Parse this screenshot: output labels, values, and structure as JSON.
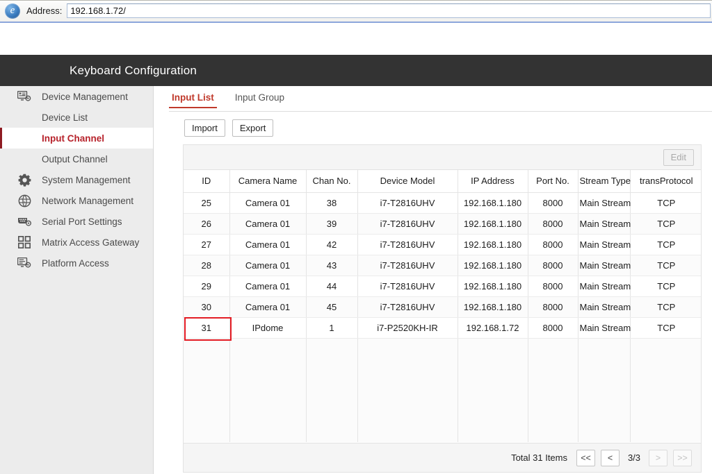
{
  "browser": {
    "icon": "internet-explorer-icon",
    "address_label": "Address:",
    "address_value": "192.168.1.72/",
    "address_placeholder": ""
  },
  "header": {
    "title": "Keyboard Configuration",
    "background": "#333333"
  },
  "sidebar": {
    "active_color": "#b7222b",
    "items": [
      {
        "label": "Device Management",
        "icon": "monitor-gear-icon",
        "type": "group",
        "active": false
      },
      {
        "label": "Device List",
        "icon": "",
        "type": "sub",
        "active": false
      },
      {
        "label": "Input Channel",
        "icon": "",
        "type": "sub",
        "active": true
      },
      {
        "label": "Output Channel",
        "icon": "",
        "type": "sub",
        "active": false
      },
      {
        "label": "System Management",
        "icon": "gear-icon",
        "type": "group",
        "active": false
      },
      {
        "label": "Network Management",
        "icon": "globe-icon",
        "type": "group",
        "active": false
      },
      {
        "label": "Serial Port Settings",
        "icon": "serial-port-gear-icon",
        "type": "group",
        "active": false
      },
      {
        "label": "Matrix Access Gateway",
        "icon": "grid-squares-icon",
        "type": "group",
        "active": false
      },
      {
        "label": "Platform Access",
        "icon": "platform-gear-icon",
        "type": "group",
        "active": false
      }
    ]
  },
  "main": {
    "tabs": [
      {
        "label": "Input List",
        "active": true
      },
      {
        "label": "Input Group",
        "active": false
      }
    ],
    "actions": {
      "import_label": "Import",
      "export_label": "Export"
    },
    "toolbar": {
      "edit_label": "Edit",
      "edit_disabled": true
    },
    "table": {
      "columns": [
        "ID",
        "Camera Name",
        "Chan No.",
        "Device Model",
        "IP Address",
        "Port No.",
        "Stream Type",
        "transProtocol"
      ],
      "rows": [
        [
          "25",
          "Camera 01",
          "38",
          "i7-T2816UHV",
          "192.168.1.180",
          "8000",
          "Main Stream",
          "TCP"
        ],
        [
          "26",
          "Camera 01",
          "39",
          "i7-T2816UHV",
          "192.168.1.180",
          "8000",
          "Main Stream",
          "TCP"
        ],
        [
          "27",
          "Camera 01",
          "42",
          "i7-T2816UHV",
          "192.168.1.180",
          "8000",
          "Main Stream",
          "TCP"
        ],
        [
          "28",
          "Camera 01",
          "43",
          "i7-T2816UHV",
          "192.168.1.180",
          "8000",
          "Main Stream",
          "TCP"
        ],
        [
          "29",
          "Camera 01",
          "44",
          "i7-T2816UHV",
          "192.168.1.180",
          "8000",
          "Main Stream",
          "TCP"
        ],
        [
          "30",
          "Camera 01",
          "45",
          "i7-T2816UHV",
          "192.168.1.180",
          "8000",
          "Main Stream",
          "TCP"
        ],
        [
          "31",
          "IPdome",
          "1",
          "i7-P2520KH-IR",
          "192.168.1.72",
          "8000",
          "Main Stream",
          "TCP"
        ]
      ],
      "highlight": {
        "row_index": 6,
        "column_index": 0,
        "color": "#e31b23"
      }
    },
    "pagination": {
      "total_text": "Total 31 Items",
      "first_label": "<<",
      "prev_label": "<",
      "indicator": "3/3",
      "next_label": ">",
      "last_label": ">>",
      "next_disabled": true,
      "last_disabled": true
    }
  }
}
